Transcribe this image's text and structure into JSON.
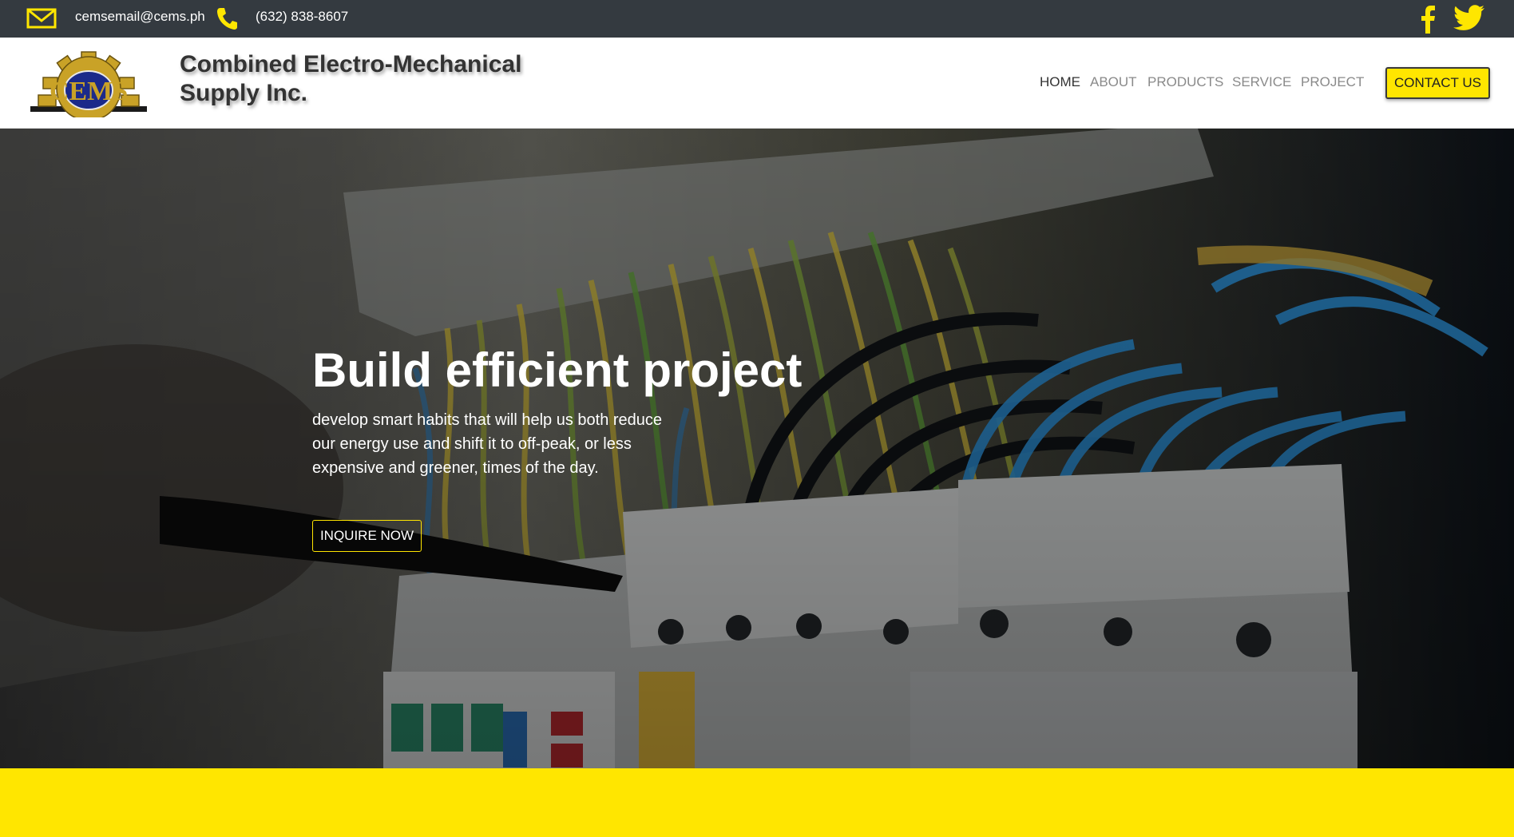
{
  "topbar": {
    "email": "cemsemail@cems.ph",
    "phone": "(632) 838-8607",
    "icons": [
      "mail-icon",
      "phone-icon",
      "facebook-icon",
      "twitter-icon"
    ],
    "icon_color": "#ffe600"
  },
  "header": {
    "logo_text": "CEMS",
    "brand_line1": "Combined Electro-Mechanical",
    "brand_line2": "Supply Inc.",
    "nav": [
      "HOME",
      "ABOUT",
      "PRODUCTS",
      "SERVICE",
      "PROJECT"
    ],
    "active_nav": "HOME",
    "contact_label": "CONTACT US"
  },
  "hero": {
    "title": "Build efficient project",
    "text": "develop smart habits that will help us both reduce our energy use and shift it to off-peak, or less expensive and greener, times of the day.",
    "button_label": "INQUIRE NOW"
  },
  "colors": {
    "accent": "#ffe600",
    "topbar": "#343a40",
    "brand_text": "#333333"
  }
}
